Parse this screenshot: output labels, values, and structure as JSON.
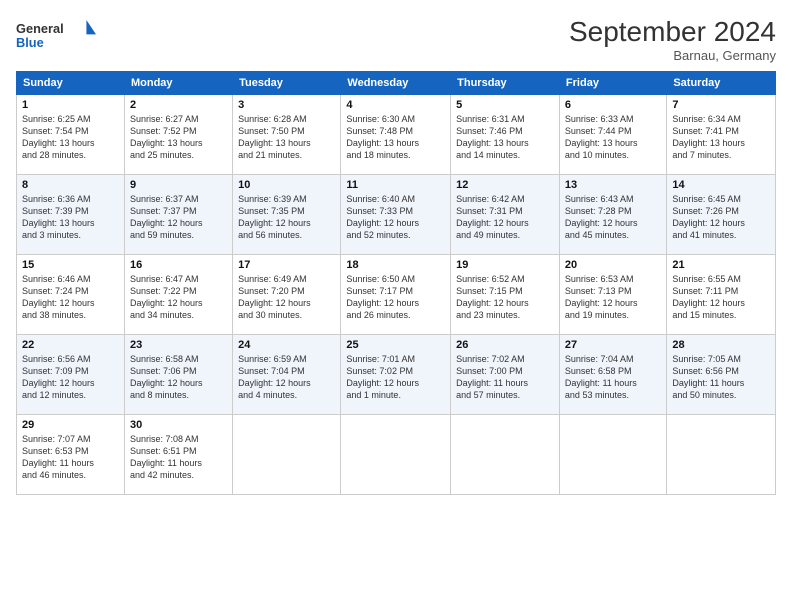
{
  "logo": {
    "line1": "General",
    "line2": "Blue"
  },
  "title": "September 2024",
  "subtitle": "Barnau, Germany",
  "headers": [
    "Sunday",
    "Monday",
    "Tuesday",
    "Wednesday",
    "Thursday",
    "Friday",
    "Saturday"
  ],
  "weeks": [
    [
      {
        "day": "1",
        "detail": "Sunrise: 6:25 AM\nSunset: 7:54 PM\nDaylight: 13 hours\nand 28 minutes."
      },
      {
        "day": "2",
        "detail": "Sunrise: 6:27 AM\nSunset: 7:52 PM\nDaylight: 13 hours\nand 25 minutes."
      },
      {
        "day": "3",
        "detail": "Sunrise: 6:28 AM\nSunset: 7:50 PM\nDaylight: 13 hours\nand 21 minutes."
      },
      {
        "day": "4",
        "detail": "Sunrise: 6:30 AM\nSunset: 7:48 PM\nDaylight: 13 hours\nand 18 minutes."
      },
      {
        "day": "5",
        "detail": "Sunrise: 6:31 AM\nSunset: 7:46 PM\nDaylight: 13 hours\nand 14 minutes."
      },
      {
        "day": "6",
        "detail": "Sunrise: 6:33 AM\nSunset: 7:44 PM\nDaylight: 13 hours\nand 10 minutes."
      },
      {
        "day": "7",
        "detail": "Sunrise: 6:34 AM\nSunset: 7:41 PM\nDaylight: 13 hours\nand 7 minutes."
      }
    ],
    [
      {
        "day": "8",
        "detail": "Sunrise: 6:36 AM\nSunset: 7:39 PM\nDaylight: 13 hours\nand 3 minutes."
      },
      {
        "day": "9",
        "detail": "Sunrise: 6:37 AM\nSunset: 7:37 PM\nDaylight: 12 hours\nand 59 minutes."
      },
      {
        "day": "10",
        "detail": "Sunrise: 6:39 AM\nSunset: 7:35 PM\nDaylight: 12 hours\nand 56 minutes."
      },
      {
        "day": "11",
        "detail": "Sunrise: 6:40 AM\nSunset: 7:33 PM\nDaylight: 12 hours\nand 52 minutes."
      },
      {
        "day": "12",
        "detail": "Sunrise: 6:42 AM\nSunset: 7:31 PM\nDaylight: 12 hours\nand 49 minutes."
      },
      {
        "day": "13",
        "detail": "Sunrise: 6:43 AM\nSunset: 7:28 PM\nDaylight: 12 hours\nand 45 minutes."
      },
      {
        "day": "14",
        "detail": "Sunrise: 6:45 AM\nSunset: 7:26 PM\nDaylight: 12 hours\nand 41 minutes."
      }
    ],
    [
      {
        "day": "15",
        "detail": "Sunrise: 6:46 AM\nSunset: 7:24 PM\nDaylight: 12 hours\nand 38 minutes."
      },
      {
        "day": "16",
        "detail": "Sunrise: 6:47 AM\nSunset: 7:22 PM\nDaylight: 12 hours\nand 34 minutes."
      },
      {
        "day": "17",
        "detail": "Sunrise: 6:49 AM\nSunset: 7:20 PM\nDaylight: 12 hours\nand 30 minutes."
      },
      {
        "day": "18",
        "detail": "Sunrise: 6:50 AM\nSunset: 7:17 PM\nDaylight: 12 hours\nand 26 minutes."
      },
      {
        "day": "19",
        "detail": "Sunrise: 6:52 AM\nSunset: 7:15 PM\nDaylight: 12 hours\nand 23 minutes."
      },
      {
        "day": "20",
        "detail": "Sunrise: 6:53 AM\nSunset: 7:13 PM\nDaylight: 12 hours\nand 19 minutes."
      },
      {
        "day": "21",
        "detail": "Sunrise: 6:55 AM\nSunset: 7:11 PM\nDaylight: 12 hours\nand 15 minutes."
      }
    ],
    [
      {
        "day": "22",
        "detail": "Sunrise: 6:56 AM\nSunset: 7:09 PM\nDaylight: 12 hours\nand 12 minutes."
      },
      {
        "day": "23",
        "detail": "Sunrise: 6:58 AM\nSunset: 7:06 PM\nDaylight: 12 hours\nand 8 minutes."
      },
      {
        "day": "24",
        "detail": "Sunrise: 6:59 AM\nSunset: 7:04 PM\nDaylight: 12 hours\nand 4 minutes."
      },
      {
        "day": "25",
        "detail": "Sunrise: 7:01 AM\nSunset: 7:02 PM\nDaylight: 12 hours\nand 1 minute."
      },
      {
        "day": "26",
        "detail": "Sunrise: 7:02 AM\nSunset: 7:00 PM\nDaylight: 11 hours\nand 57 minutes."
      },
      {
        "day": "27",
        "detail": "Sunrise: 7:04 AM\nSunset: 6:58 PM\nDaylight: 11 hours\nand 53 minutes."
      },
      {
        "day": "28",
        "detail": "Sunrise: 7:05 AM\nSunset: 6:56 PM\nDaylight: 11 hours\nand 50 minutes."
      }
    ],
    [
      {
        "day": "29",
        "detail": "Sunrise: 7:07 AM\nSunset: 6:53 PM\nDaylight: 11 hours\nand 46 minutes."
      },
      {
        "day": "30",
        "detail": "Sunrise: 7:08 AM\nSunset: 6:51 PM\nDaylight: 11 hours\nand 42 minutes."
      },
      null,
      null,
      null,
      null,
      null
    ]
  ]
}
